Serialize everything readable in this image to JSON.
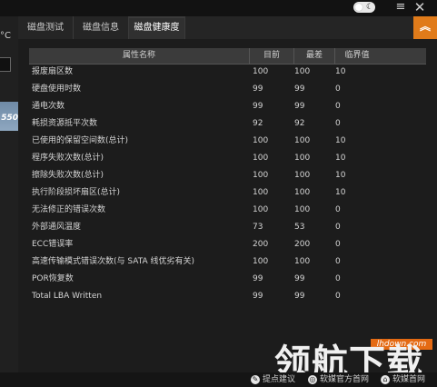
{
  "left_panel": {
    "temp_fragment": "°C",
    "image_text": "550"
  },
  "tabs": [
    {
      "label": "磁盘测试"
    },
    {
      "label": "磁盘信息"
    },
    {
      "label": "磁盘健康度"
    }
  ],
  "table": {
    "headers": {
      "name": "属性名称",
      "current": "目前",
      "worst": "最差",
      "threshold": "临界值"
    },
    "rows": [
      {
        "name": "报废扇区数",
        "current": "100",
        "worst": "100",
        "threshold": "10"
      },
      {
        "name": "硬盘使用时数",
        "current": "99",
        "worst": "99",
        "threshold": "0"
      },
      {
        "name": "通电次数",
        "current": "99",
        "worst": "99",
        "threshold": "0"
      },
      {
        "name": "耗损资源抵平次数",
        "current": "92",
        "worst": "92",
        "threshold": "0"
      },
      {
        "name": "已使用的保留空间数(总计)",
        "current": "100",
        "worst": "100",
        "threshold": "10"
      },
      {
        "name": "程序失败次数(总计)",
        "current": "100",
        "worst": "100",
        "threshold": "10"
      },
      {
        "name": "擦除失败次数(总计)",
        "current": "100",
        "worst": "100",
        "threshold": "10"
      },
      {
        "name": "执行阶段损坏扇区(总计)",
        "current": "100",
        "worst": "100",
        "threshold": "10"
      },
      {
        "name": "无法修正的错误次数",
        "current": "100",
        "worst": "100",
        "threshold": "0"
      },
      {
        "name": "外部通风温度",
        "current": "73",
        "worst": "53",
        "threshold": "0"
      },
      {
        "name": "ECC错误率",
        "current": "200",
        "worst": "200",
        "threshold": "0"
      },
      {
        "name": "高速传输模式错误次数(与 SATA 线优劣有关)",
        "current": "100",
        "worst": "100",
        "threshold": "0"
      },
      {
        "name": "POR恢复数",
        "current": "99",
        "worst": "99",
        "threshold": "0"
      },
      {
        "name": "Total LBA Written",
        "current": "99",
        "worst": "99",
        "threshold": "0"
      }
    ]
  },
  "status_bar": {
    "feedback": "提点建议",
    "website": "软媒官方首网",
    "more": "软媒首网"
  },
  "watermark": {
    "url": "lhdown.com",
    "text": "领航下载"
  },
  "icons": {
    "toggle": "moon-icon",
    "menu": "menu-icon",
    "close": "close-icon",
    "badge": "double-chevron-up-icon"
  },
  "colors": {
    "accent": "#e07b1a",
    "background": "#1a1a1a"
  }
}
